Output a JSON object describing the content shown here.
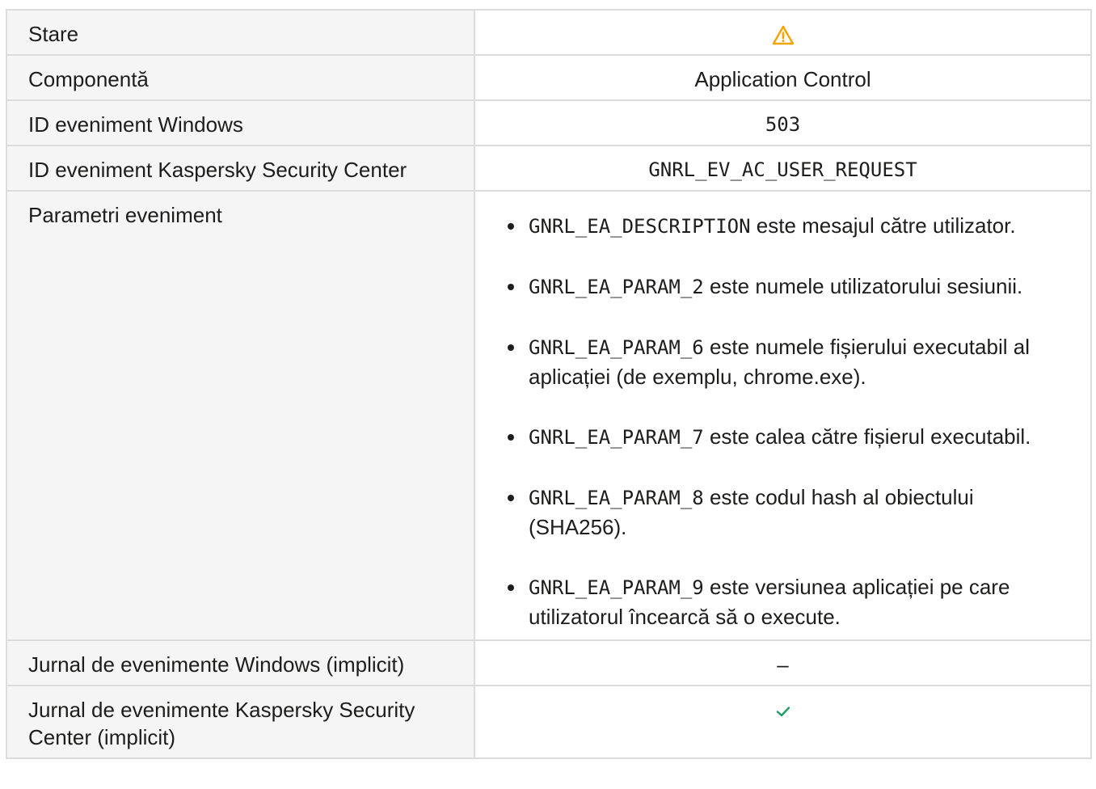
{
  "rows": {
    "status": {
      "label": "Stare",
      "icon": "warning-icon",
      "icon_color": "#f5a300"
    },
    "component": {
      "label": "Componentă",
      "value": "Application Control"
    },
    "windows_event_id": {
      "label": "ID eveniment Windows",
      "value": "503"
    },
    "ksc_event_id": {
      "label": "ID eveniment Kaspersky Security Center",
      "value": "GNRL_EV_AC_USER_REQUEST"
    },
    "event_params": {
      "label": "Parametri eveniment",
      "items": [
        {
          "code": "GNRL_EA_DESCRIPTION",
          "text": " este mesajul către utilizator."
        },
        {
          "code": "GNRL_EA_PARAM_2",
          "text": " este numele utilizatorului sesiunii."
        },
        {
          "code": "GNRL_EA_PARAM_6",
          "text": " este numele fișierului executabil al aplicației (de exemplu, chrome.exe)."
        },
        {
          "code": "GNRL_EA_PARAM_7",
          "text": " este calea către fișierul executabil."
        },
        {
          "code": "GNRL_EA_PARAM_8",
          "text": " este codul hash al obiectului (SHA256)."
        },
        {
          "code": "GNRL_EA_PARAM_9",
          "text": " este versiunea aplicației pe care utilizatorul încearcă să o execute."
        }
      ]
    },
    "windows_log": {
      "label": "Jurnal de evenimente Windows (implicit)",
      "value": "–"
    },
    "ksc_log": {
      "label": "Jurnal de evenimente Kaspersky Security Center (implicit)",
      "icon": "checkmark-icon",
      "icon_color": "#1e9e64"
    }
  }
}
